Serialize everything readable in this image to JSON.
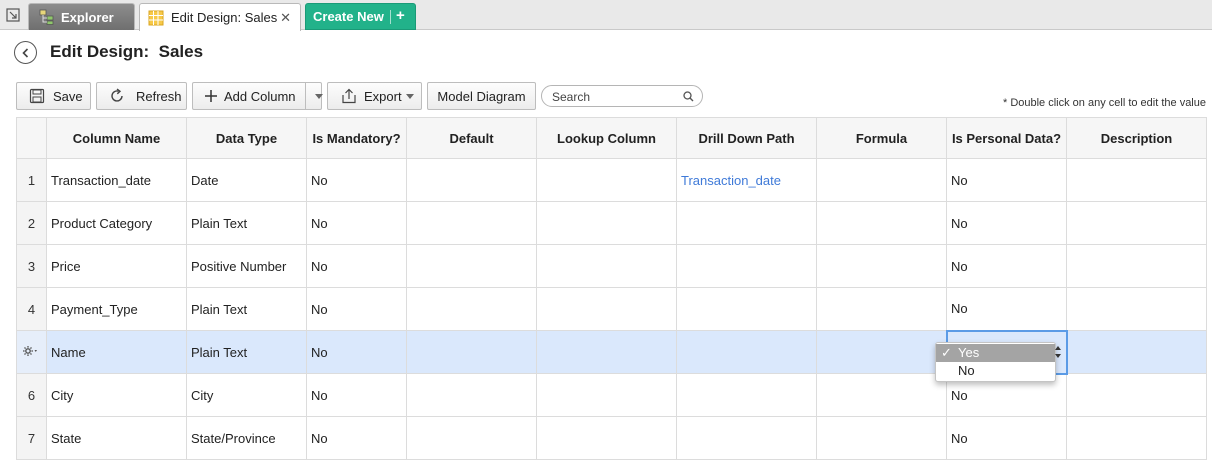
{
  "tabs": {
    "explorer_label": "Explorer",
    "active_label": "Edit Design: Sales",
    "close_glyph": "✕",
    "create_new_label": "Create New",
    "create_new_plus": "+"
  },
  "header": {
    "title": "Edit Design:  Sales"
  },
  "toolbar": {
    "save_label": "Save",
    "refresh_label": "Refresh",
    "add_column_label": "Add Column",
    "export_label": "Export",
    "model_diagram_label": "Model Diagram",
    "search_placeholder": "Search",
    "hint": "* Double click on any cell to edit the value"
  },
  "table": {
    "columns": [
      "Column Name",
      "Data Type",
      "Is Mandatory?",
      "Default",
      "Lookup Column",
      "Drill Down Path",
      "Formula",
      "Is Personal Data?",
      "Description"
    ],
    "rows": [
      {
        "num": "1",
        "name": "Transaction_date",
        "type": "Date",
        "mandatory": "No",
        "default": "",
        "lookup": "",
        "drill": "Transaction_date",
        "formula": "",
        "personal": "No",
        "description": ""
      },
      {
        "num": "2",
        "name": "Product Category",
        "type": "Plain Text",
        "mandatory": "No",
        "default": "",
        "lookup": "",
        "drill": "",
        "formula": "",
        "personal": "No",
        "description": ""
      },
      {
        "num": "3",
        "name": "Price",
        "type": "Positive Number",
        "mandatory": "No",
        "default": "",
        "lookup": "",
        "drill": "",
        "formula": "",
        "personal": "No",
        "description": ""
      },
      {
        "num": "4",
        "name": "Payment_Type",
        "type": "Plain Text",
        "mandatory": "No",
        "default": "",
        "lookup": "",
        "drill": "",
        "formula": "",
        "personal": "No",
        "description": ""
      },
      {
        "num": "",
        "name": "Name",
        "type": "Plain Text",
        "mandatory": "No",
        "default": "",
        "lookup": "",
        "drill": "",
        "formula": "",
        "personal": "",
        "description": ""
      },
      {
        "num": "6",
        "name": "City",
        "type": "City",
        "mandatory": "No",
        "default": "",
        "lookup": "",
        "drill": "",
        "formula": "",
        "personal": "No",
        "description": ""
      },
      {
        "num": "7",
        "name": "State",
        "type": "State/Province",
        "mandatory": "No",
        "default": "",
        "lookup": "",
        "drill": "",
        "formula": "",
        "personal": "No",
        "description": ""
      }
    ]
  },
  "dropdown": {
    "options": [
      "Yes",
      "No"
    ],
    "selected_mark": "✓"
  },
  "colors": {
    "accent_green": "#22b28a",
    "link_blue": "#3f7ad8",
    "selected_row": "#dae8fc",
    "focus_border": "#5b9be6"
  },
  "icons": {
    "corner": "collapse-panel-icon",
    "explorer": "explorer-tree-icon",
    "table": "table-grid-icon",
    "back": "back-arrow-icon",
    "save": "save-disk-icon",
    "refresh": "refresh-icon",
    "add": "plus-icon",
    "export": "export-upload-icon",
    "search": "search-icon",
    "row_settings": "gear-icon"
  }
}
